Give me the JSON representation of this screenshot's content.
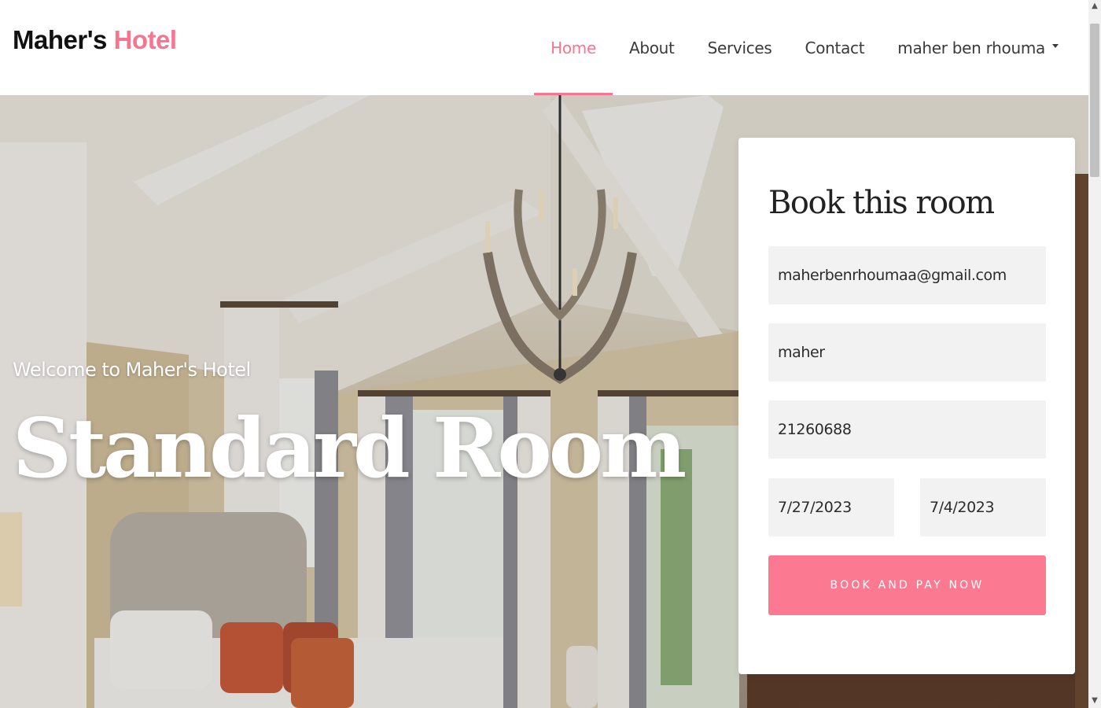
{
  "brand": {
    "name": "Maher's",
    "accent": "Hotel"
  },
  "nav": {
    "items": [
      {
        "label": "Home",
        "active": true
      },
      {
        "label": "About",
        "active": false
      },
      {
        "label": "Services",
        "active": false
      },
      {
        "label": "Contact",
        "active": false
      }
    ],
    "user": "maher ben rhouma"
  },
  "hero": {
    "welcome": "Welcome to Maher's Hotel",
    "title": "Standard Room"
  },
  "booking": {
    "title": "Book this room",
    "email": "maherbenrhoumaa@gmail.com",
    "name": "maher",
    "phone": "21260688",
    "check_in": "7/27/2023",
    "check_out": "7/4/2023",
    "button": "BOOK AND PAY NOW"
  },
  "colors": {
    "accent": "#f8758f",
    "button": "#fb7a92",
    "field_bg": "#f2f2f2"
  },
  "icons": {
    "user_menu": "caret-down-icon",
    "scroll_up": "arrow-up-icon",
    "scroll_down": "arrow-down-icon"
  }
}
